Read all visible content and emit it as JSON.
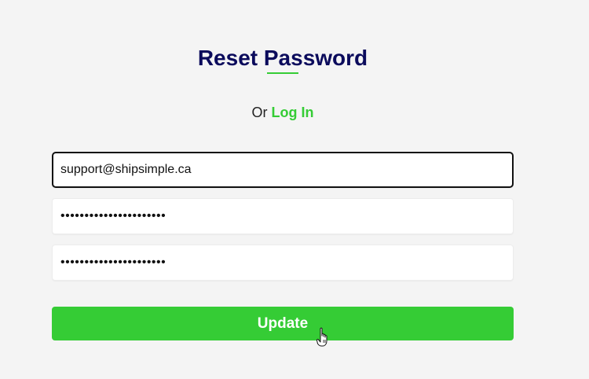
{
  "header": {
    "title": "Reset Password"
  },
  "subline": {
    "prefix": "Or",
    "login_link": "Log In"
  },
  "form": {
    "email": {
      "value": "support@shipsimple.ca"
    },
    "password": {
      "value": "••••••••••••••••••••••"
    },
    "confirm_password": {
      "value": "••••••••••••••••••••••"
    },
    "submit_label": "Update"
  },
  "colors": {
    "accent": "#35cc35",
    "title": "#0b0b5c",
    "background": "#f4f4f4"
  },
  "icons": {
    "cursor": "hand-pointer-icon"
  }
}
